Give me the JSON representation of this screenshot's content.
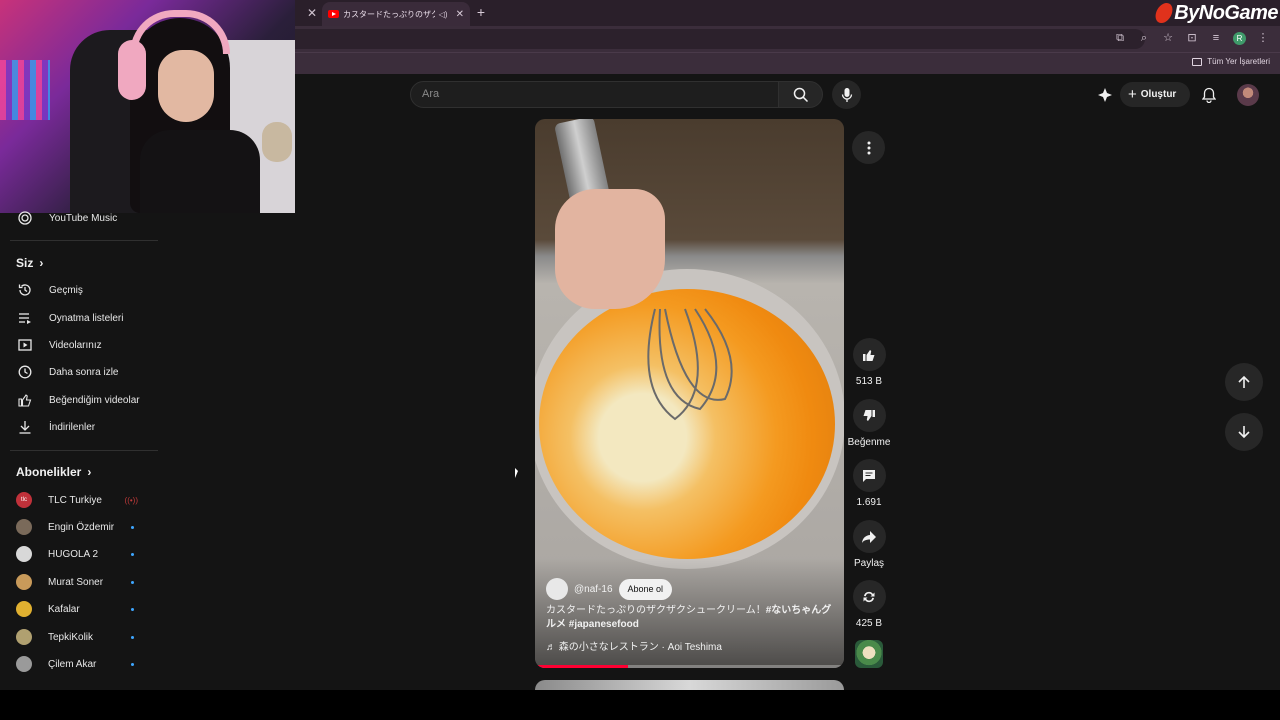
{
  "browser": {
    "tab_title": "カスタードたっぷりのザクザクシュ",
    "bookmarks_all": "Tüm Yer İşaretleri",
    "profile_initial": "R"
  },
  "brand": {
    "name": "ByNoGame"
  },
  "header": {
    "search_placeholder": "Ara",
    "create_label": "Oluştur"
  },
  "sidebar": {
    "top_item": "YouTube Music",
    "you_section": "Siz",
    "you_items": [
      {
        "label": "Geçmiş",
        "icon": "history-icon"
      },
      {
        "label": "Oynatma listeleri",
        "icon": "playlists-icon"
      },
      {
        "label": "Videolarınız",
        "icon": "your-videos-icon"
      },
      {
        "label": "Daha sonra izle",
        "icon": "watch-later-icon"
      },
      {
        "label": "Beğendiğim videolar",
        "icon": "liked-videos-icon"
      },
      {
        "label": "İndirilenler",
        "icon": "downloads-icon"
      }
    ],
    "subs_section": "Abonelikler",
    "subscriptions": [
      {
        "name": "TLC Turkiye",
        "indicator": "live",
        "color": "#c0313a"
      },
      {
        "name": "Engin Özdemir",
        "indicator": "new",
        "color": "#7a6a5a"
      },
      {
        "name": "HUGOLA 2",
        "indicator": "new",
        "color": "#d8d8d8"
      },
      {
        "name": "Murat Soner",
        "indicator": "new",
        "color": "#c89a5a"
      },
      {
        "name": "Kafalar",
        "indicator": "new",
        "color": "#e0b030"
      },
      {
        "name": "TepkiKolik",
        "indicator": "new",
        "color": "#b0a070"
      },
      {
        "name": "Çilem Akar",
        "indicator": "new",
        "color": "#9a9a9a"
      }
    ]
  },
  "short": {
    "channel_handle": "@naf-16",
    "subscribe_label": "Abone ol",
    "title_text": "カスタードたっぷりのザクザクシュークリーム！",
    "title_tags": "#ないちゃんグルメ #japanesefood",
    "music": "♬ 森の小さなレストラン · Aoi Teshima",
    "progress": 0.3
  },
  "actions": {
    "likes": "513 B",
    "dislike_label": "Beğenme",
    "comments": "1.691",
    "share_label": "Paylaş",
    "remix_count": "425 B"
  },
  "colors": {
    "accent": "#ff0033",
    "background": "#141414",
    "button_bg": "#272727"
  }
}
